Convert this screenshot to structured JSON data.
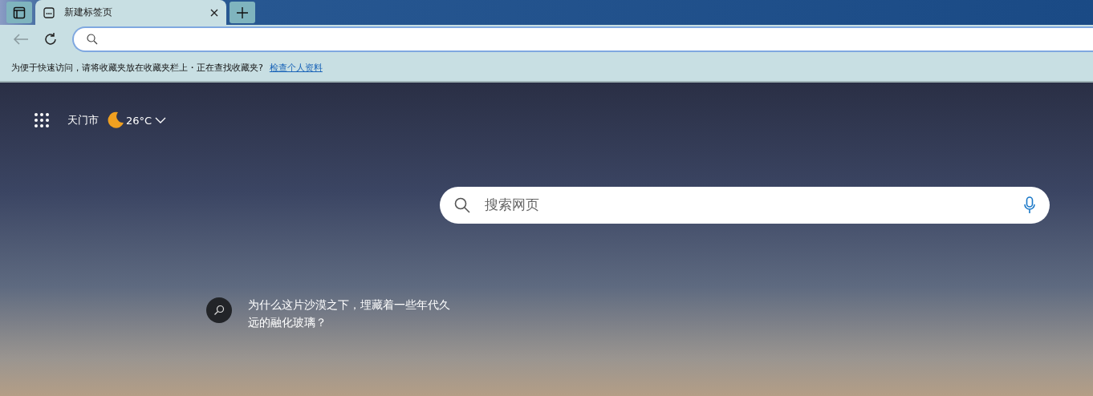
{
  "tabs": [
    {
      "label": "新建标签页",
      "selected": true
    }
  ],
  "favorites_bar": {
    "message": "为便于快速访问，请将收藏夹放在收藏夹栏上・正在查找收藏夹?",
    "link": "检查个人资料"
  },
  "weather": {
    "city": "天门市",
    "temperature": "26°C"
  },
  "search": {
    "placeholder": "搜索网页"
  },
  "suggestion": {
    "text": "为什么这片沙漠之下，埋藏着一些年代久远的融化玻璃？"
  }
}
